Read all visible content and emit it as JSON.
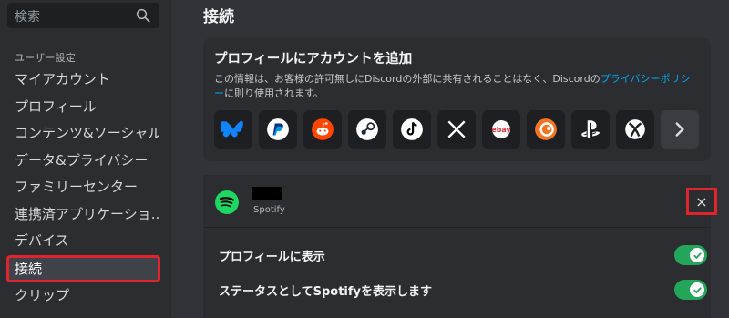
{
  "sidebar": {
    "search_placeholder": "検索",
    "section_header": "ユーザー設定",
    "items": [
      {
        "label": "マイアカウント"
      },
      {
        "label": "プロフィール"
      },
      {
        "label": "コンテンツ&ソーシャル"
      },
      {
        "label": "データ&プライバシー"
      },
      {
        "label": "ファミリーセンター"
      },
      {
        "label": "連携済アプリケーショ..."
      },
      {
        "label": "デバイス"
      },
      {
        "label": "接続"
      },
      {
        "label": "クリップ"
      }
    ],
    "active_index": 7
  },
  "main": {
    "title": "接続",
    "add_card": {
      "title": "プロフィールにアカウントを追加",
      "desc_before": "この情報は、お客様の許可無しにDiscordの外部に共有されることはなく、Discordの",
      "desc_link": "プライバシーポリシー",
      "desc_after": "に則り使用されます。",
      "services": [
        "bluesky-icon",
        "paypal-icon",
        "reddit-icon",
        "steam-icon",
        "tiktok-icon",
        "x-icon",
        "ebay-icon",
        "crunchyroll-icon",
        "playstation-icon",
        "xbox-icon",
        "chevron-right-icon"
      ],
      "ebay_label": "ebay"
    },
    "connection": {
      "service": "Spotify",
      "close_symbol": "×",
      "toggles": [
        {
          "label": "プロフィールに表示",
          "on": true
        },
        {
          "label": "ステータスとしてSpotifyを表示します",
          "on": true
        }
      ]
    }
  },
  "colors": {
    "accent_green": "#23a55a",
    "highlight_red": "#e0242b",
    "link_blue": "#00a8fc",
    "spotify_green": "#1ed760"
  }
}
